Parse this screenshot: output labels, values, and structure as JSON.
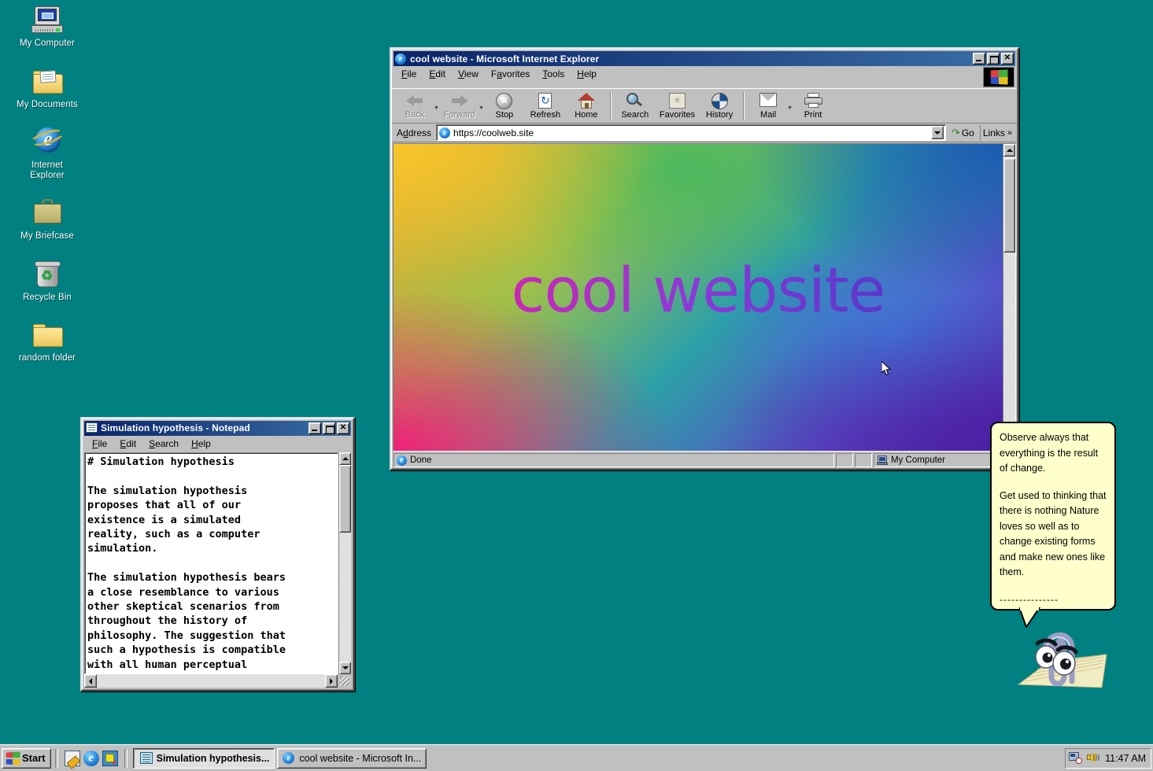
{
  "desktop": {
    "background_color": "#008080",
    "icons": [
      {
        "label": "My Computer",
        "icon": "computer-icon"
      },
      {
        "label": "My Documents",
        "icon": "documents-folder-icon"
      },
      {
        "label": "Internet\nExplorer",
        "label_line1": "Internet",
        "label_line2": "Explorer",
        "icon": "internet-explorer-icon"
      },
      {
        "label": "My Briefcase",
        "icon": "briefcase-icon"
      },
      {
        "label": "Recycle Bin",
        "icon": "recycle-bin-icon"
      },
      {
        "label": "random folder",
        "icon": "folder-icon"
      }
    ]
  },
  "ie_window": {
    "title": "cool website - Microsoft Internet Explorer",
    "title_icon": "internet-explorer-icon",
    "window_buttons": {
      "minimize": "_",
      "maximize": "□",
      "close": "✕"
    },
    "menu": [
      {
        "label": "File",
        "accel": "F"
      },
      {
        "label": "Edit",
        "accel": "E"
      },
      {
        "label": "View",
        "accel": "V"
      },
      {
        "label": "Favorites",
        "accel": "a"
      },
      {
        "label": "Tools",
        "accel": "T"
      },
      {
        "label": "Help",
        "accel": "H"
      }
    ],
    "toolbar": [
      {
        "label": "Back",
        "icon": "back-arrow-icon",
        "disabled": true,
        "has_dropdown": true
      },
      {
        "label": "Forward",
        "icon": "forward-arrow-icon",
        "disabled": true,
        "has_dropdown": true
      },
      {
        "label": "Stop",
        "icon": "stop-icon",
        "disabled": false
      },
      {
        "label": "Refresh",
        "icon": "refresh-icon",
        "disabled": false
      },
      {
        "label": "Home",
        "icon": "home-icon",
        "disabled": false
      },
      {
        "label": "Search",
        "icon": "search-icon",
        "disabled": false
      },
      {
        "label": "Favorites",
        "icon": "favorites-star-icon",
        "disabled": false
      },
      {
        "label": "History",
        "icon": "history-clock-icon",
        "disabled": false
      },
      {
        "label": "Mail",
        "icon": "mail-icon",
        "disabled": false,
        "has_dropdown": true
      },
      {
        "label": "Print",
        "icon": "printer-icon",
        "disabled": false
      }
    ],
    "address": {
      "label": "Address",
      "value": "https://coolweb.site",
      "placeholder": "https://",
      "favicon": "internet-explorer-icon",
      "go_label": "Go",
      "links_label": "Links",
      "links_chevron": "»"
    },
    "page": {
      "heading": "cool website",
      "gradient_colors": {
        "top_left": "#f7c62a",
        "top_mid": "#4cb85e",
        "top_right": "#1a5cb0",
        "bottom_left": "#f01f79",
        "bottom_right": "#4a20a4"
      },
      "heading_gradient_start": "#e8218f",
      "heading_gradient_end": "#5432c0"
    },
    "status": {
      "text": "Done",
      "zone": "My Computer",
      "zone_icon": "computer-icon"
    }
  },
  "notepad_window": {
    "title": "Simulation hypothesis - Notepad",
    "title_icon": "notepad-icon",
    "window_buttons": {
      "minimize": "_",
      "maximize": "□",
      "close": "✕"
    },
    "menu": [
      {
        "label": "File",
        "accel": "F"
      },
      {
        "label": "Edit",
        "accel": "E"
      },
      {
        "label": "Search",
        "accel": "S"
      },
      {
        "label": "Help",
        "accel": "H"
      }
    ],
    "content": "# Simulation hypothesis\n\nThe simulation hypothesis\nproposes that all of our\nexistence is a simulated\nreality, such as a computer\nsimulation.\n\nThe simulation hypothesis bears\na close resemblance to various\nother skeptical scenarios from\nthroughout the history of\nphilosophy. The suggestion that\nsuch a hypothesis is compatible\nwith all human perceptual"
  },
  "clippy": {
    "character": "paperclip-assistant",
    "balloon": {
      "paragraph1": "Observe always that everything is the result of change.",
      "paragraph2": "Get used to thinking that there is nothing Nature loves so well as to change existing forms and make new ones like them.",
      "divider": "---------------"
    }
  },
  "taskbar": {
    "start_label": "Start",
    "start_icon": "windows-flag-icon",
    "quicklaunch": [
      {
        "icon": "notepad-quicklaunch-icon",
        "name": "notepad"
      },
      {
        "icon": "internet-explorer-quicklaunch-icon",
        "name": "internet-explorer"
      },
      {
        "icon": "show-desktop-icon",
        "name": "show-desktop"
      }
    ],
    "tasks": [
      {
        "label": "Simulation hypothesis...",
        "icon": "notepad-icon",
        "active": true
      },
      {
        "label": "cool website - Microsoft In...",
        "icon": "internet-explorer-icon",
        "active": false
      }
    ],
    "tray": {
      "icons": [
        {
          "name": "task-scheduler-icon"
        },
        {
          "name": "volume-icon"
        }
      ],
      "time": "11:47 AM"
    }
  }
}
